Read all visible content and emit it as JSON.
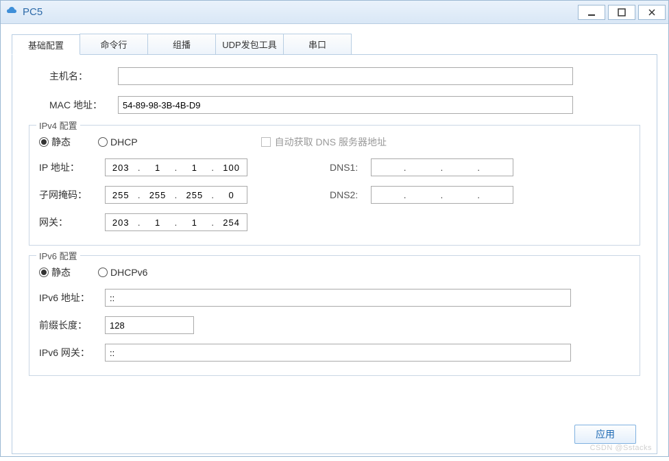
{
  "window": {
    "title": "PC5"
  },
  "tabs": [
    "基础配置",
    "命令行",
    "组播",
    "UDP发包工具",
    "串口"
  ],
  "active_tab": 0,
  "basic": {
    "hostname_label": "主机名：",
    "hostname_value": "",
    "mac_label": "MAC 地址：",
    "mac_value": "54-89-98-3B-4B-D9"
  },
  "ipv4": {
    "legend": "IPv4 配置",
    "radio_static": "静态",
    "radio_dhcp": "DHCP",
    "auto_dns": "自动获取 DNS 服务器地址",
    "ip_label": "IP 地址：",
    "ip": [
      "203",
      "1",
      "1",
      "100"
    ],
    "mask_label": "子网掩码：",
    "mask": [
      "255",
      "255",
      "255",
      "0"
    ],
    "gw_label": "网关：",
    "gw": [
      "203",
      "1",
      "1",
      "254"
    ],
    "dns1_label": "DNS1:",
    "dns1": [
      "",
      "",
      "",
      ""
    ],
    "dns2_label": "DNS2:",
    "dns2": [
      "",
      "",
      "",
      ""
    ]
  },
  "ipv6": {
    "legend": "IPv6 配置",
    "radio_static": "静态",
    "radio_dhcp": "DHCPv6",
    "addr_label": "IPv6 地址：",
    "addr_value": "::",
    "prefix_label": "前缀长度：",
    "prefix_value": "128",
    "gw_label": "IPv6 网关：",
    "gw_value": "::"
  },
  "apply_label": "应用",
  "watermark": "CSDN @Sstacks"
}
